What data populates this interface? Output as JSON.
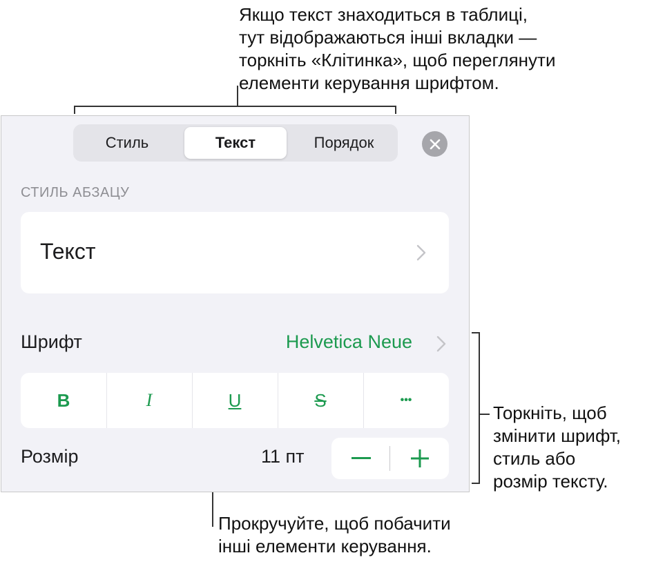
{
  "callouts": {
    "top": "Якщо текст знаходиться в таблиці,\nтут відображаються інші вкладки —\nторкніть «Клітинка», щоб переглянути\nелементи керування шрифтом.",
    "right": "Торкніть, щоб\nзмінити шрифт,\nстиль або\nрозмір тексту.",
    "bottom": "Прокручуйте, щоб побачити\nінші елементи керування."
  },
  "tabs": [
    {
      "label": "Стиль",
      "active": false
    },
    {
      "label": "Текст",
      "active": true
    },
    {
      "label": "Порядок",
      "active": false
    }
  ],
  "paragraph_style": {
    "header": "СТИЛЬ АБЗАЦУ",
    "value": "Текст"
  },
  "font": {
    "label": "Шрифт",
    "value": "Helvetica Neue"
  },
  "format_buttons": {
    "bold": "B",
    "italic": "I",
    "underline": "U",
    "strikethrough": "S",
    "more": "•••"
  },
  "size": {
    "label": "Розмір",
    "value": "11 пт"
  },
  "colors": {
    "accent": "#1c9a4f",
    "panel_bg": "#f2f2f7",
    "secondary_text": "#8e8e93"
  },
  "icons": {
    "close": "close-icon",
    "chevron": "chevron-right-icon",
    "minus": "minus-icon",
    "plus": "plus-icon"
  }
}
